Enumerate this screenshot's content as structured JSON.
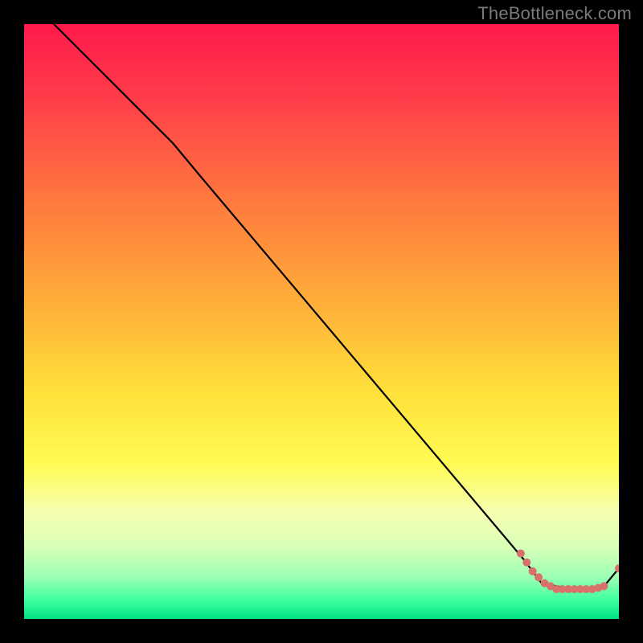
{
  "watermark": "TheBottleneck.com",
  "chart_data": {
    "type": "line",
    "title": "",
    "xlabel": "",
    "ylabel": "",
    "xlim": [
      0,
      100
    ],
    "ylim": [
      0,
      100
    ],
    "gradient_stops": [
      {
        "offset": 0,
        "color": "#ff1a4b"
      },
      {
        "offset": 12,
        "color": "#ff3b4a"
      },
      {
        "offset": 30,
        "color": "#ff7a3e"
      },
      {
        "offset": 48,
        "color": "#ffb23a"
      },
      {
        "offset": 62,
        "color": "#ffe13a"
      },
      {
        "offset": 74,
        "color": "#fffb55"
      },
      {
        "offset": 82,
        "color": "#f6ffb0"
      },
      {
        "offset": 88,
        "color": "#d8ffb8"
      },
      {
        "offset": 93,
        "color": "#9cffb4"
      },
      {
        "offset": 97,
        "color": "#3bff9e"
      },
      {
        "offset": 100,
        "color": "#00e183"
      }
    ],
    "series": [
      {
        "name": "bottleneck-curve",
        "type": "line",
        "color": "#000000",
        "points": [
          {
            "x": 5,
            "y": 100
          },
          {
            "x": 25,
            "y": 80
          },
          {
            "x": 30,
            "y": 74
          },
          {
            "x": 84,
            "y": 10
          },
          {
            "x": 87,
            "y": 6
          },
          {
            "x": 92,
            "y": 5
          },
          {
            "x": 97.5,
            "y": 5.5
          },
          {
            "x": 100,
            "y": 8.5
          }
        ]
      },
      {
        "name": "data-dots",
        "type": "scatter",
        "color": "#d9716b",
        "points": [
          {
            "x": 83.5,
            "y": 11
          },
          {
            "x": 84.5,
            "y": 9.5
          },
          {
            "x": 85.5,
            "y": 8
          },
          {
            "x": 86.5,
            "y": 7
          },
          {
            "x": 87.5,
            "y": 6
          },
          {
            "x": 88.5,
            "y": 5.5
          },
          {
            "x": 89.5,
            "y": 5
          },
          {
            "x": 90.5,
            "y": 5
          },
          {
            "x": 91.5,
            "y": 5
          },
          {
            "x": 92.5,
            "y": 5
          },
          {
            "x": 93.5,
            "y": 5
          },
          {
            "x": 94.5,
            "y": 5
          },
          {
            "x": 95.5,
            "y": 5
          },
          {
            "x": 96.5,
            "y": 5.2
          },
          {
            "x": 97.5,
            "y": 5.5
          },
          {
            "x": 100,
            "y": 8.5
          }
        ]
      }
    ]
  }
}
